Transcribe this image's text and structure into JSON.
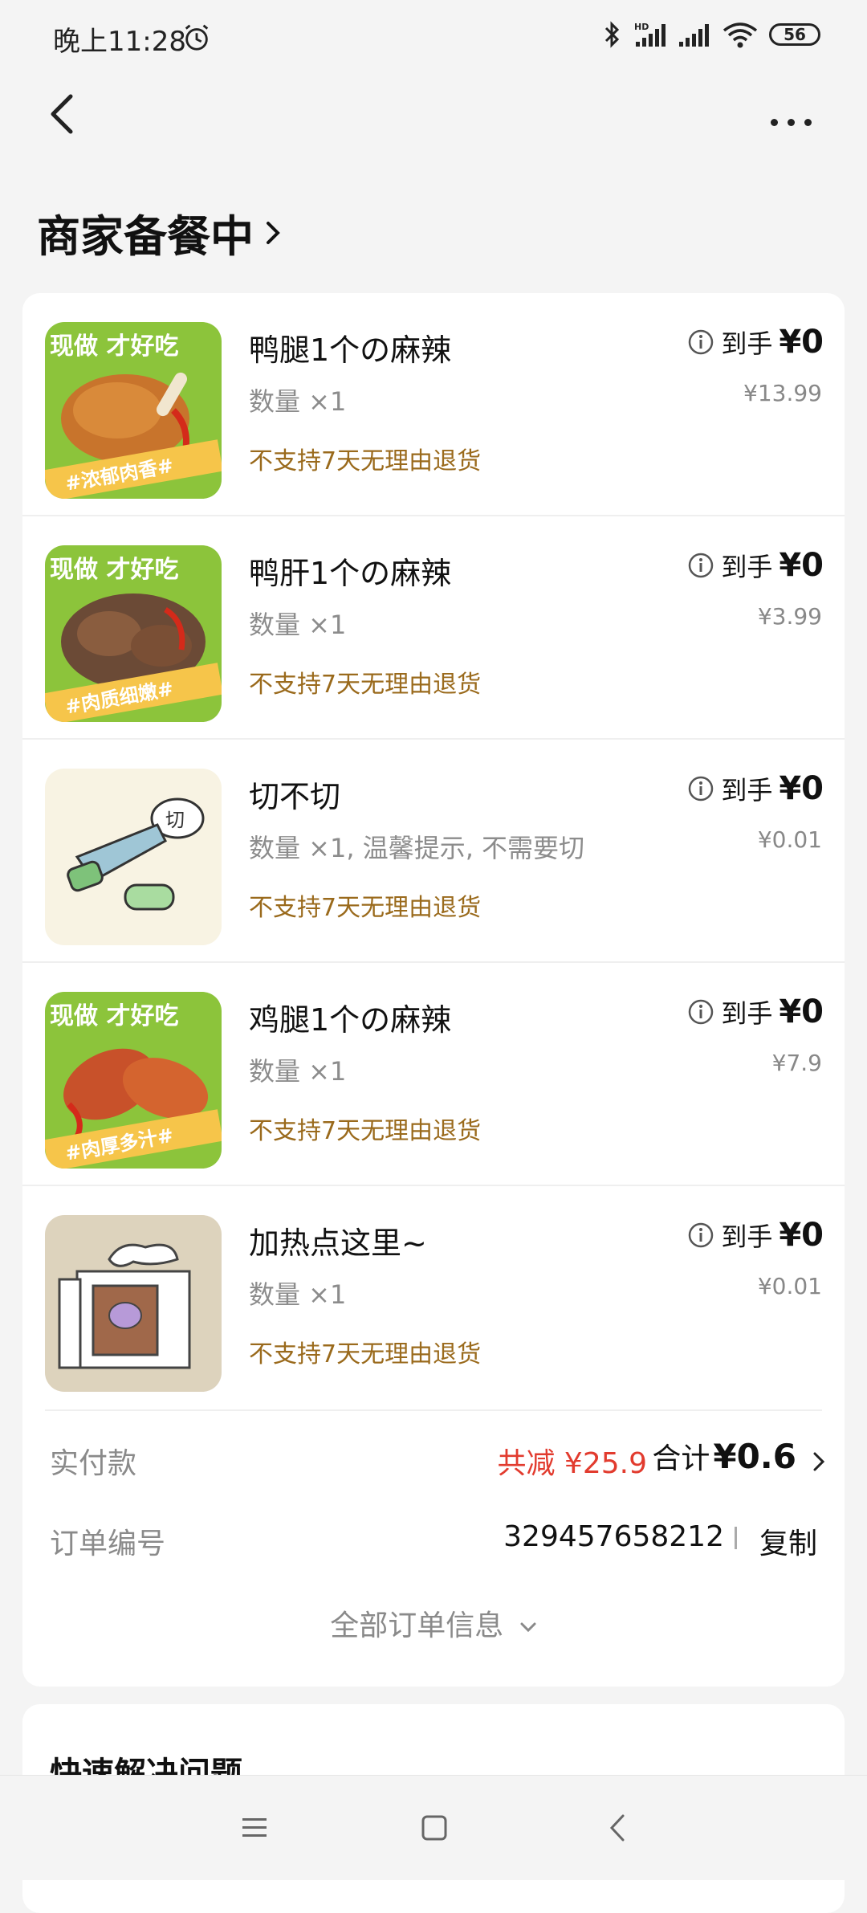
{
  "status": {
    "time": "晚上11:28",
    "battery": "56",
    "net": "HD"
  },
  "page": {
    "title": "商家备餐中"
  },
  "items": [
    {
      "name": "鸭腿1个の麻辣",
      "qty": "数量 ×1",
      "notice": "不支持7天无理由退货",
      "price_label": "到手",
      "price": "¥0",
      "original": "¥13.99",
      "thumb_caption": "#浓郁肉香#",
      "thumb_header": "现做 才好吃"
    },
    {
      "name": "鸭肝1个の麻辣",
      "qty": "数量 ×1",
      "notice": "不支持7天无理由退货",
      "price_label": "到手",
      "price": "¥0",
      "original": "¥3.99",
      "thumb_caption": "#肉质细嫩#",
      "thumb_header": "现做 才好吃"
    },
    {
      "name": "切不切",
      "qty": "数量 ×1, 温馨提示, 不需要切",
      "notice": "不支持7天无理由退货",
      "price_label": "到手",
      "price": "¥0",
      "original": "¥0.01",
      "thumb_caption": "切"
    },
    {
      "name": "鸡腿1个の麻辣",
      "qty": "数量 ×1",
      "notice": "不支持7天无理由退货",
      "price_label": "到手",
      "price": "¥0",
      "original": "¥7.9",
      "thumb_caption": "#肉厚多汁#",
      "thumb_header": "现做 才好吃"
    },
    {
      "name": "加热点这里~",
      "qty": "数量 ×1",
      "notice": "不支持7天无理由退货",
      "price_label": "到手",
      "price": "¥0",
      "original": "¥0.01"
    }
  ],
  "summary": {
    "paid_label": "实付款",
    "discount": "共减 ¥25.9",
    "total_label": "合计",
    "total_value": "¥0.6",
    "order_label": "订单编号",
    "order_number": "329457658212",
    "copy_label": "复制",
    "all_info": "全部订单信息"
  },
  "section2": {
    "title": "快速解决问题"
  },
  "colors": {
    "discount": "#e23b2e",
    "notice": "#9a6a1c",
    "thumb_green": "#8cc43b"
  }
}
